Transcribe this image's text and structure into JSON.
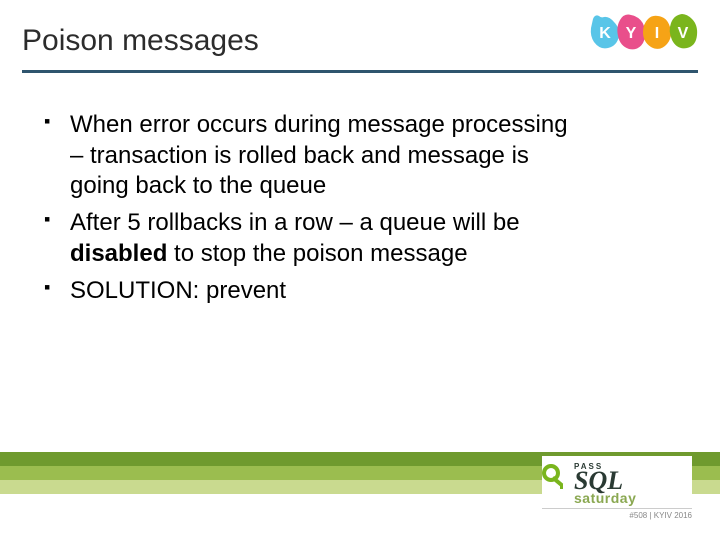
{
  "header": {
    "title": "Poison messages",
    "logo_letters": [
      "K",
      "Y",
      "I",
      "V"
    ],
    "logo_colors": [
      "#59c5e8",
      "#e94f8b",
      "#f6a316",
      "#7ab51d"
    ]
  },
  "bullets": [
    {
      "pre": "When error occurs during message processing – transaction is rolled back and message is going back to the queue",
      "bold": "",
      "post": ""
    },
    {
      "pre": "After 5 rollbacks in a row – a queue will be ",
      "bold": "disabled",
      "post": " to stop the poison message"
    },
    {
      "pre": "SOLUTION: prevent",
      "bold": "",
      "post": ""
    }
  ],
  "footer": {
    "pass": "PASS",
    "sql": "SQL",
    "saturday": "saturday",
    "tag": "#508 | KYIV 2016"
  }
}
